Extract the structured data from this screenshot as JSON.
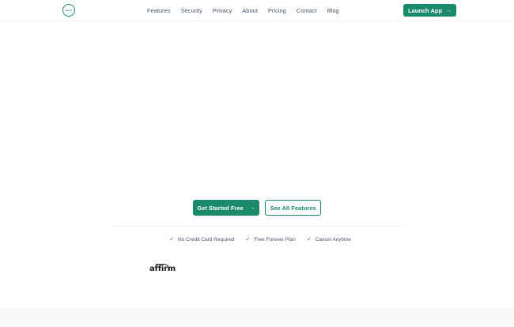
{
  "nav": {
    "logo_text": "Kazu",
    "links": [
      "Features",
      "Security",
      "Privacy",
      "About",
      "Pricing",
      "Contact",
      "Blog"
    ],
    "launch_label": "Launch App",
    "launch_arrow": "→"
  },
  "hero": {
    "primary_label": "Get Started Free",
    "primary_arrow": "→",
    "secondary_label": "See All Features"
  },
  "features": [
    {
      "icon": "check-icon",
      "label": "No Credit Card Required"
    },
    {
      "icon": "check-icon",
      "label": "Free Forever Plan"
    },
    {
      "icon": "check-icon",
      "label": "Cancel Anytime"
    }
  ],
  "partners": [
    {
      "name": "affirm"
    }
  ],
  "colors": {
    "accent": "#1a8a6a",
    "text": "#4a5568",
    "footer_band": "#f8f9fa"
  }
}
